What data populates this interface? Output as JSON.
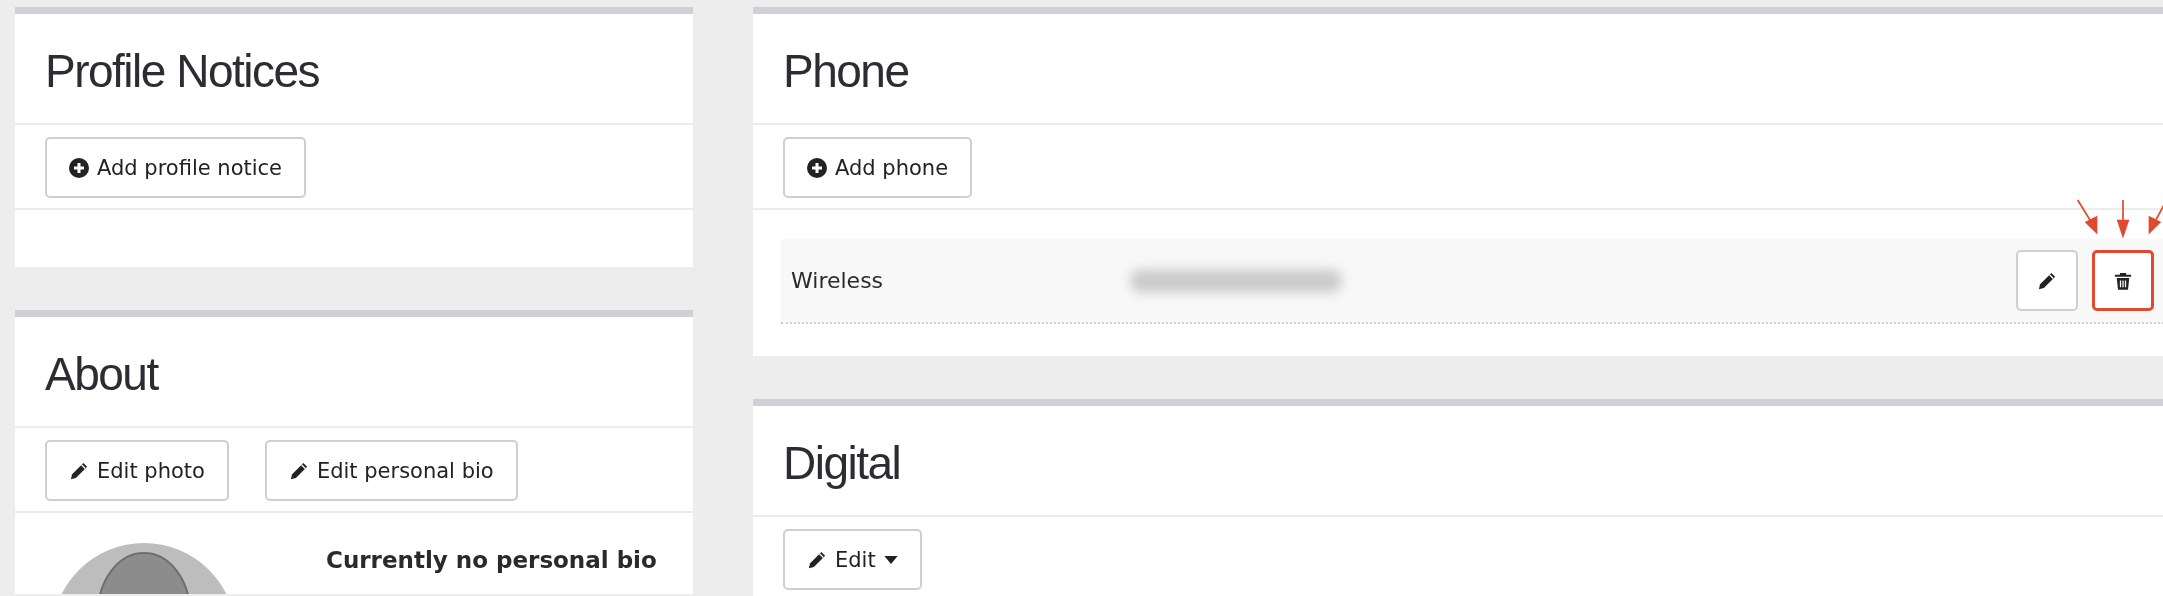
{
  "left_column": [
    {
      "title": "Profile Notices",
      "buttons": [
        {
          "label": "Add profile notice",
          "kind": "add"
        }
      ]
    },
    {
      "title": "About",
      "buttons": [
        {
          "label": "Edit photo",
          "kind": "edit"
        },
        {
          "label": "Edit personal bio",
          "kind": "edit"
        }
      ],
      "bio": {
        "kind": "picture",
        "text": "Currently no personal bio"
      }
    }
  ],
  "right_column": [
    {
      "title": "Phone",
      "buttons": [
        {
          "label": "Add phone",
          "kind": "add"
        }
      ],
      "rows": [
        {
          "type": "Wireless",
          "actions": [
            {
              "kind": "edit",
              "highlighted": false
            },
            {
              "kind": "delete",
              "highlighted": true
            }
          ]
        }
      ]
    },
    {
      "title": "Digital",
      "buttons": [
        {
          "label": "Edit",
          "kind": "edit",
          "dropdown": true
        }
      ]
    }
  ]
}
